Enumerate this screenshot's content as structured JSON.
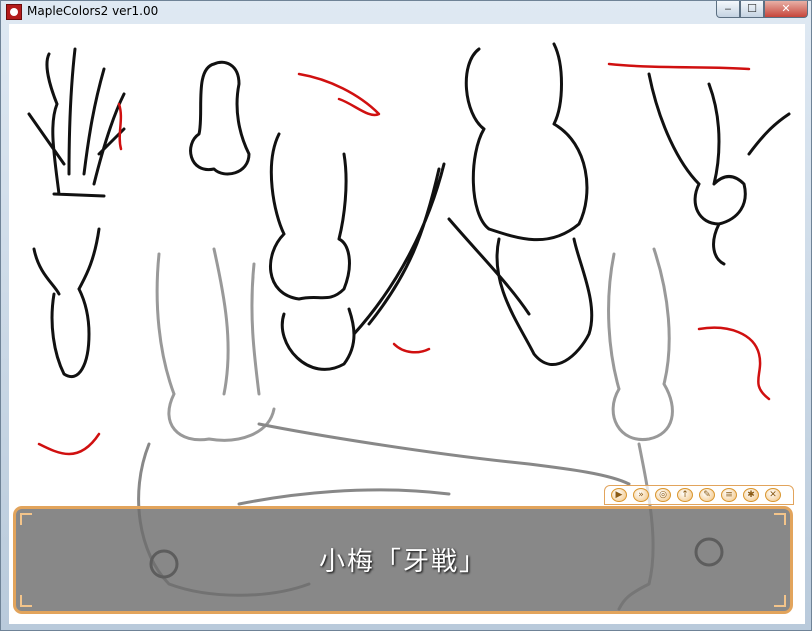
{
  "window": {
    "title": "MapleColors2 ver1.00",
    "minimize_glyph": "‒",
    "maximize_glyph": "☐",
    "close_glyph": "✕"
  },
  "dialogue": {
    "text": "小梅「牙戦」"
  },
  "toolbar": {
    "icons": [
      "play-icon",
      "skip-icon",
      "auto-icon",
      "back-icon",
      "quick-save-icon",
      "log-icon",
      "config-icon",
      "close-window-icon"
    ],
    "glyphs": [
      "▶",
      "»",
      "◎",
      "↑",
      "✎",
      "≡",
      "✱",
      "✕"
    ]
  },
  "colors": {
    "frame_border": "#e2a45c",
    "ink": "#111111",
    "blood": "#d01010"
  }
}
